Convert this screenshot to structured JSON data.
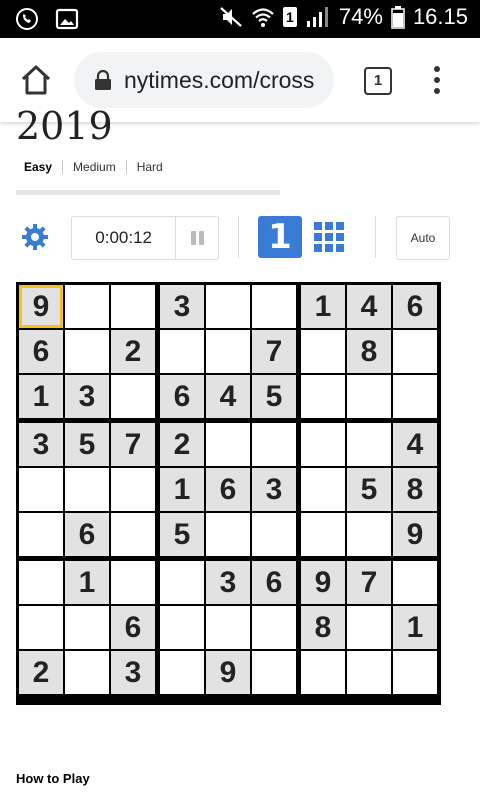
{
  "status_bar": {
    "battery": "74%",
    "time": "16.15",
    "sim_slot": "1"
  },
  "browser": {
    "url": "nytimes.com/crosswords",
    "tab_count": "1"
  },
  "page": {
    "year": "2019",
    "difficulty_tabs": [
      "Easy",
      "Medium",
      "Hard"
    ],
    "active_difficulty": "Easy",
    "timer": "0:00:12",
    "mode_single_label": "1",
    "auto_label": "Auto",
    "how_to_play": "How to Play"
  },
  "colors": {
    "accent": "#3a7bd5",
    "given_cell": "#e2e2e2",
    "selection": "#f0c419"
  },
  "sudoku": {
    "selected": [
      0,
      0
    ],
    "given": [
      [
        1,
        0,
        0,
        1,
        0,
        0,
        1,
        1,
        1
      ],
      [
        1,
        0,
        1,
        0,
        0,
        1,
        0,
        1,
        0
      ],
      [
        1,
        1,
        0,
        1,
        1,
        1,
        0,
        0,
        0
      ],
      [
        1,
        1,
        1,
        1,
        0,
        0,
        0,
        0,
        1
      ],
      [
        0,
        0,
        0,
        1,
        1,
        1,
        0,
        1,
        1
      ],
      [
        0,
        1,
        0,
        1,
        0,
        0,
        0,
        0,
        1
      ],
      [
        0,
        1,
        0,
        0,
        1,
        1,
        1,
        1,
        0
      ],
      [
        0,
        0,
        1,
        0,
        0,
        0,
        1,
        0,
        1
      ],
      [
        1,
        0,
        1,
        0,
        1,
        0,
        0,
        0,
        0
      ]
    ],
    "values": [
      [
        "9",
        "",
        "",
        "3",
        "",
        "",
        "1",
        "4",
        "6"
      ],
      [
        "6",
        "",
        "2",
        "",
        "",
        "7",
        "",
        "8",
        ""
      ],
      [
        "1",
        "3",
        "",
        "6",
        "4",
        "5",
        "",
        "",
        ""
      ],
      [
        "3",
        "5",
        "7",
        "2",
        "",
        "",
        "",
        "",
        "4"
      ],
      [
        "",
        "",
        "",
        "1",
        "6",
        "3",
        "",
        "5",
        "8"
      ],
      [
        "",
        "6",
        "",
        "5",
        "",
        "",
        "",
        "",
        "9"
      ],
      [
        "",
        "1",
        "",
        "",
        "3",
        "6",
        "9",
        "7",
        ""
      ],
      [
        "",
        "",
        "6",
        "",
        "",
        "",
        "8",
        "",
        "1"
      ],
      [
        "2",
        "",
        "3",
        "",
        "9",
        "",
        "",
        "",
        ""
      ]
    ]
  }
}
